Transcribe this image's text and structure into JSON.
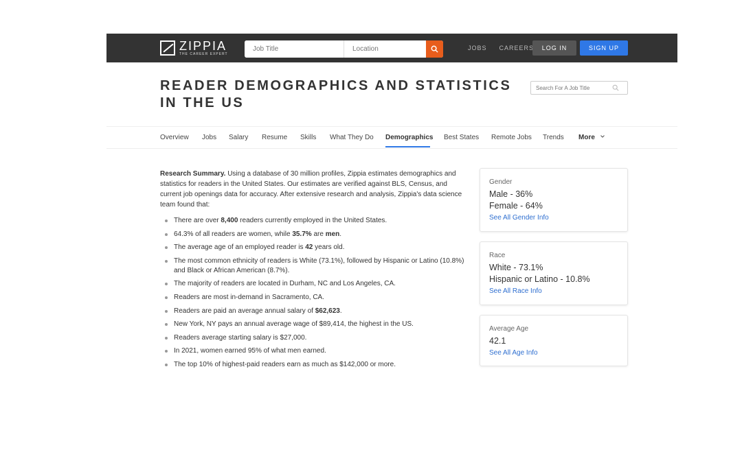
{
  "header": {
    "logo_name": "ZIPPIA",
    "logo_tagline": "THE CAREER EXPERT",
    "job_placeholder": "Job Title",
    "location_placeholder": "Location",
    "nav": [
      "JOBS",
      "CAREERS"
    ],
    "login_label": "LOG IN",
    "signup_label": "SIGN UP"
  },
  "page": {
    "title": "READER DEMOGRAPHICS AND STATISTICS IN THE US",
    "job_search_placeholder": "Search For A Job Title"
  },
  "tabs": [
    {
      "label": "Overview"
    },
    {
      "label": "Jobs"
    },
    {
      "label": "Salary"
    },
    {
      "label": "Resume"
    },
    {
      "label": "Skills"
    },
    {
      "label": "What They Do"
    },
    {
      "label": "Demographics"
    },
    {
      "label": "Best States"
    },
    {
      "label": "Remote Jobs"
    },
    {
      "label": "Trends"
    },
    {
      "label": "More"
    }
  ],
  "summary": {
    "heading": "Research Summary.",
    "text": "Using a database of 30 million profiles, Zippia estimates demographics and statistics for readers in the United States. Our estimates are verified against BLS, Census, and current job openings data for accuracy. After extensive research and analysis, Zippia's data science team found that:"
  },
  "bullets": {
    "b1_pre": "There are over ",
    "b1_bold": "8,400",
    "b1_post": " readers currently employed in the United States.",
    "b2_pre": "64.3% of all readers are women, while ",
    "b2_bold1": "35.7%",
    "b2_mid": " are ",
    "b2_bold2": "men",
    "b2_post": ".",
    "b3_pre": "The average age of an employed reader is ",
    "b3_bold": "42",
    "b3_post": " years old.",
    "b4": "The most common ethnicity of readers is White (73.1%), followed by Hispanic or Latino (10.8%) and Black or African American (8.7%).",
    "b5": "The majority of readers are located in Durham, NC and Los Angeles, CA.",
    "b6": "Readers are most in-demand in Sacramento, CA.",
    "b7_pre": "Readers are paid an average annual salary of ",
    "b7_bold": "$62,623",
    "b7_post": ".",
    "b8": "New York, NY pays an annual average wage of $89,414, the highest in the US.",
    "b9": "Readers average starting salary is $27,000.",
    "b10": "In 2021, women earned 95% of what men earned.",
    "b11": "The top 10% of highest-paid readers earn as much as $142,000 or more."
  },
  "cards": {
    "gender": {
      "label": "Gender",
      "line1": "Male - 36%",
      "line2": "Female - 64%",
      "link": "See All Gender Info"
    },
    "race": {
      "label": "Race",
      "line1": "White - 73.1%",
      "line2": "Hispanic or Latino - 10.8%",
      "link": "See All Race Info"
    },
    "age": {
      "label": "Average Age",
      "line1": "42.1",
      "link": "See All Age Info"
    }
  },
  "colors": {
    "accent": "#2f78e6",
    "search_button": "#e85d1c",
    "header_bg": "#333333"
  }
}
